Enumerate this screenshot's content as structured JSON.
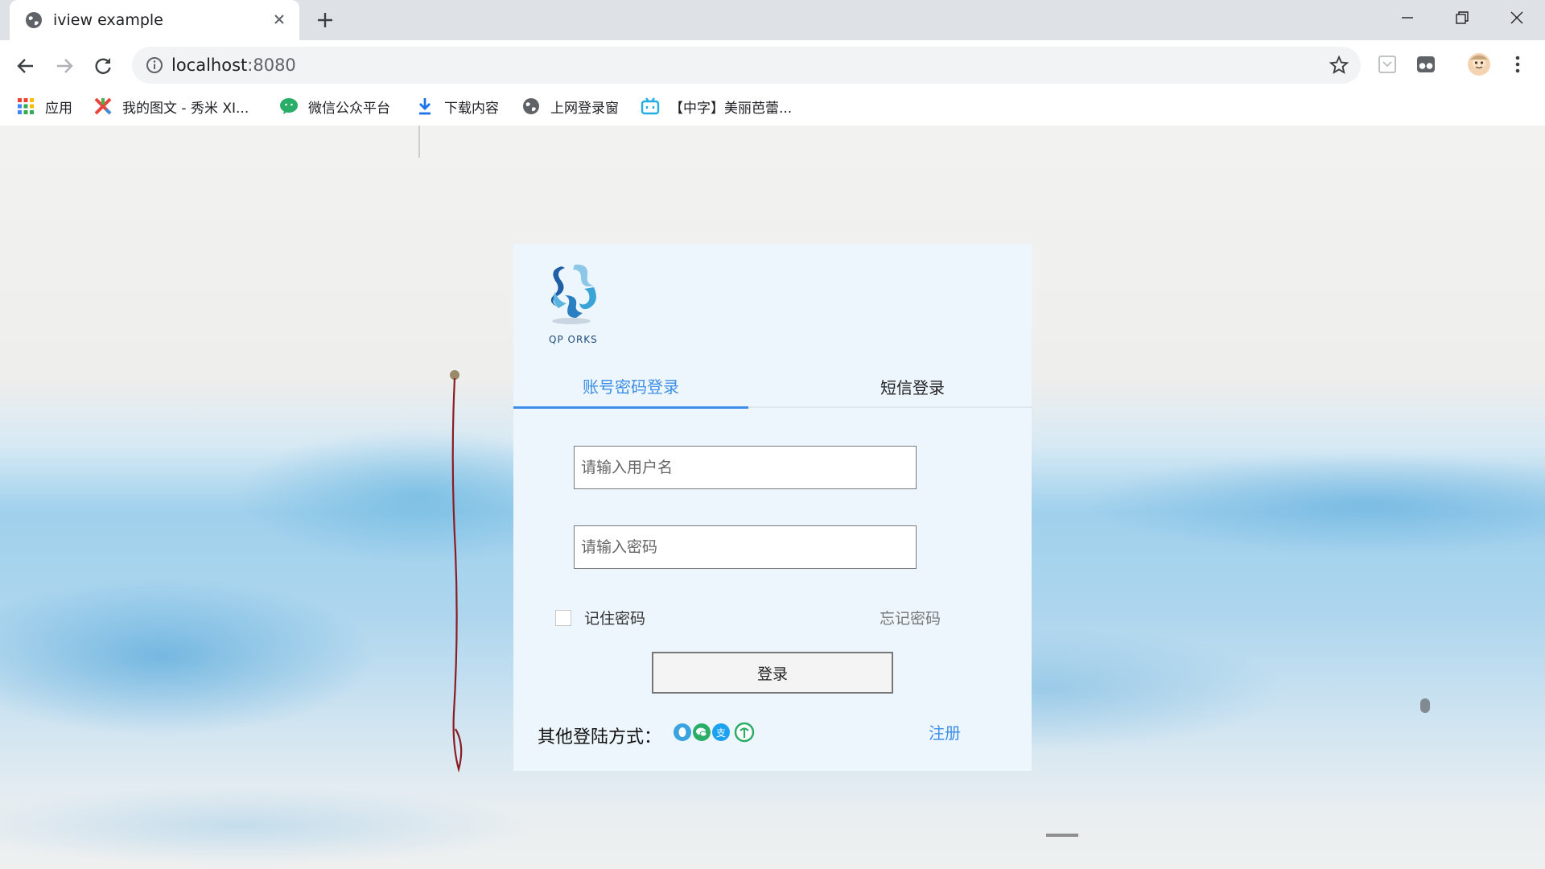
{
  "browser": {
    "tab_title": "iview example",
    "url_host": "localhost",
    "url_port": ":8080",
    "bookmarks": [
      {
        "label": "应用",
        "icon": "apps-grid-icon"
      },
      {
        "label": "我的图文 - 秀米 XI...",
        "icon": "xiumi-icon"
      },
      {
        "label": "微信公众平台",
        "icon": "wechat-icon"
      },
      {
        "label": "下载内容",
        "icon": "download-icon"
      },
      {
        "label": "上网登录窗",
        "icon": "globe-icon"
      },
      {
        "label": "【中字】美丽芭蕾...",
        "icon": "bilibili-icon"
      }
    ]
  },
  "login": {
    "logo_text": "QP  ORKS",
    "tabs": [
      {
        "label": "账号密码登录",
        "active": true
      },
      {
        "label": "短信登录",
        "active": false
      }
    ],
    "username_placeholder": "请输入用户名",
    "password_placeholder": "请输入密码",
    "remember_label": "记住密码",
    "forgot_label": "忘记密码",
    "submit_label": "登录",
    "other_label": "其他登陆方式：",
    "social_icons": [
      "qq-icon",
      "wechat-icon",
      "alipay-icon",
      "weibo-icon"
    ],
    "register_label": "注册",
    "colors": {
      "accent": "#3c8ee6",
      "card_bg": "#eef6fd"
    }
  }
}
